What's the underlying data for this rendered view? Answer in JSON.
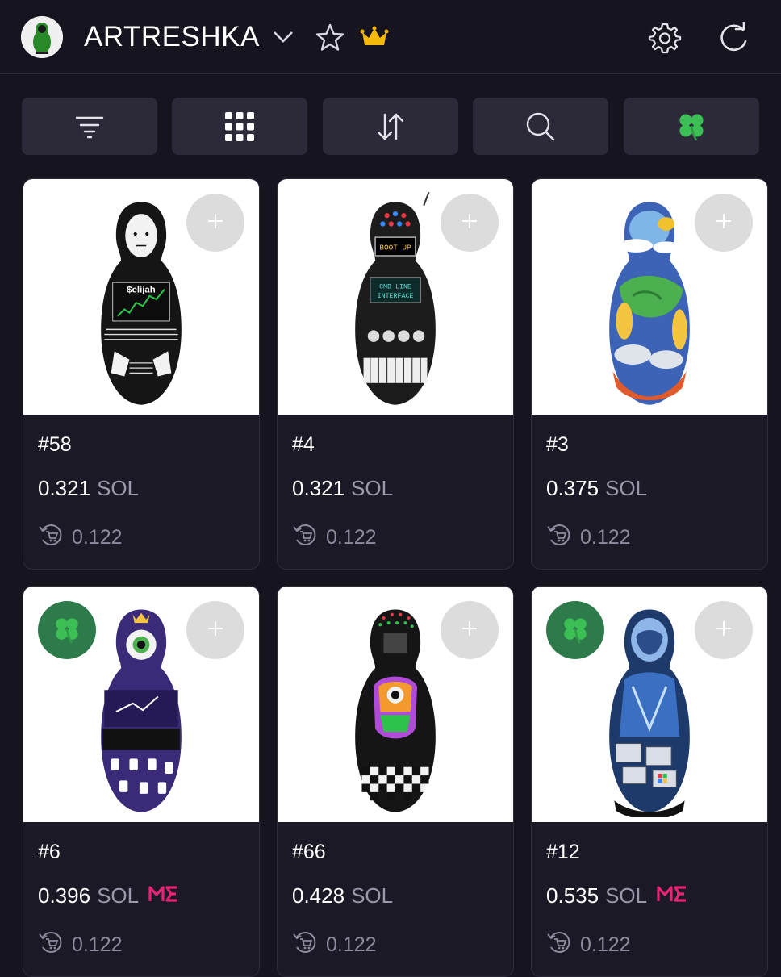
{
  "header": {
    "collection_name": "ARTRESHKA",
    "icons": [
      "collection-avatar-icon",
      "chevron-down-icon",
      "star-icon",
      "crown-icon",
      "gear-icon",
      "refresh-icon"
    ],
    "crown_color": "#f5b90a"
  },
  "toolbar": {
    "buttons": [
      {
        "name": "filter-button",
        "icon": "filter-icon"
      },
      {
        "name": "grid-view-button",
        "icon": "grid-icon"
      },
      {
        "name": "sort-button",
        "icon": "sort-icon"
      },
      {
        "name": "search-button",
        "icon": "search-icon"
      },
      {
        "name": "lucky-button",
        "icon": "clover-icon"
      }
    ]
  },
  "items": [
    {
      "id": "#58",
      "price": "0.321",
      "unit": "SOL",
      "loan": "0.122",
      "magic_eden": false,
      "lucky": false,
      "art": "elijah-doll"
    },
    {
      "id": "#4",
      "price": "0.321",
      "unit": "SOL",
      "loan": "0.122",
      "magic_eden": false,
      "lucky": false,
      "art": "robot-doll"
    },
    {
      "id": "#3",
      "price": "0.375",
      "unit": "SOL",
      "loan": "0.122",
      "magic_eden": false,
      "lucky": false,
      "art": "fantasy-doll"
    },
    {
      "id": "#6",
      "price": "0.396",
      "unit": "SOL",
      "loan": "0.122",
      "magic_eden": true,
      "lucky": true,
      "art": "eye-doll"
    },
    {
      "id": "#66",
      "price": "0.428",
      "unit": "SOL",
      "loan": "0.122",
      "magic_eden": false,
      "lucky": false,
      "art": "psychedelic-doll"
    },
    {
      "id": "#12",
      "price": "0.535",
      "unit": "SOL",
      "loan": "0.122",
      "magic_eden": true,
      "lucky": true,
      "art": "cyber-doll"
    }
  ],
  "colors": {
    "background": "#16141f",
    "card": "#1b1926",
    "toolbar_button": "#2c2a39",
    "magic_eden": "#e42575",
    "clover": "#3cbf55"
  }
}
